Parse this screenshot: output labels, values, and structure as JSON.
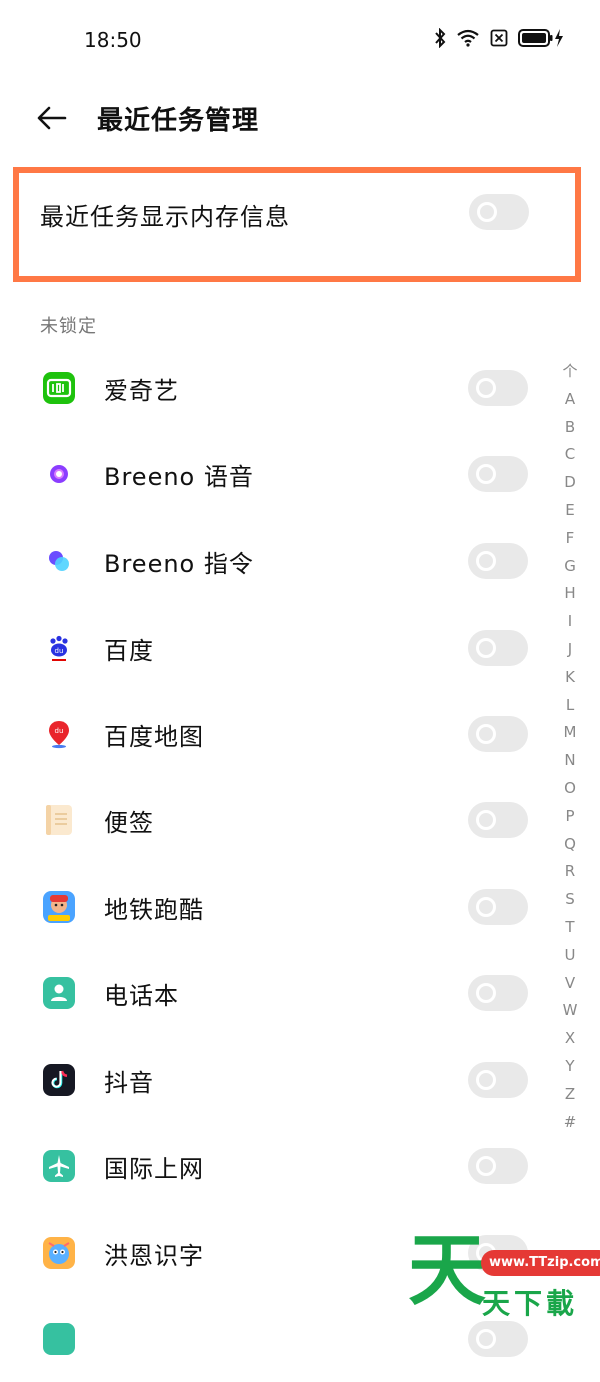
{
  "status_bar": {
    "time": "18:50"
  },
  "header": {
    "title": "最近任务管理"
  },
  "memory_setting": {
    "label": "最近任务显示内存信息",
    "enabled": false
  },
  "section": {
    "label": "未锁定"
  },
  "apps": [
    {
      "name": "爱奇艺",
      "icon": "iqiyi-icon",
      "locked": false
    },
    {
      "name": "Breeno 语音",
      "icon": "breeno-voice-icon",
      "locked": false
    },
    {
      "name": "Breeno 指令",
      "icon": "breeno-command-icon",
      "locked": false
    },
    {
      "name": "百度",
      "icon": "baidu-icon",
      "locked": false
    },
    {
      "name": "百度地图",
      "icon": "baidu-map-icon",
      "locked": false
    },
    {
      "name": "便签",
      "icon": "notes-icon",
      "locked": false
    },
    {
      "name": "地铁跑酷",
      "icon": "subway-surfers-icon",
      "locked": false
    },
    {
      "name": "电话本",
      "icon": "contacts-icon",
      "locked": false
    },
    {
      "name": "抖音",
      "icon": "douyin-icon",
      "locked": false
    },
    {
      "name": "国际上网",
      "icon": "international-roaming-icon",
      "locked": false
    },
    {
      "name": "洪恩识字",
      "icon": "hongen-icon",
      "locked": false
    }
  ],
  "alpha_index": [
    "个",
    "A",
    "B",
    "C",
    "D",
    "E",
    "F",
    "G",
    "H",
    "I",
    "J",
    "K",
    "L",
    "M",
    "N",
    "O",
    "P",
    "Q",
    "R",
    "S",
    "T",
    "U",
    "V",
    "W",
    "X",
    "Y",
    "Z",
    "#"
  ],
  "watermark": {
    "domain": "www.TTzip.com",
    "big": "天",
    "text": "天下載"
  },
  "colors": {
    "accent_border": "#ff7845",
    "toggle_off": "#e9e9e9",
    "watermark_green": "#1aa64a"
  }
}
